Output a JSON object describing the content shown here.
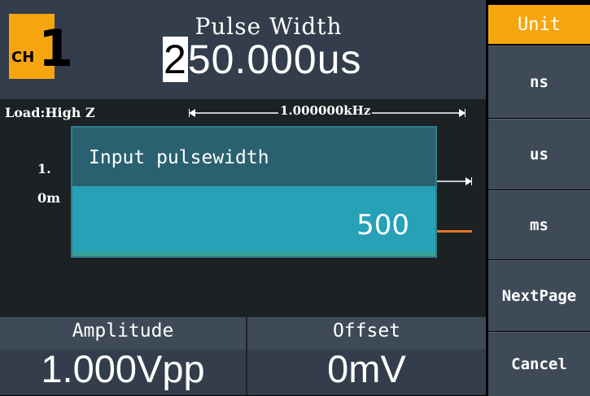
{
  "channel": {
    "label": "CH",
    "number": "1"
  },
  "param": {
    "title": "Pulse Width",
    "value_first_digit": "2",
    "value_rest": "50.000us"
  },
  "waveform": {
    "load": "Load:High Z",
    "frequency": "1.000000kHz",
    "amplitude_tag": "1.",
    "offset_tag": "0m"
  },
  "dialog": {
    "title": "Input pulsewidth",
    "value": "500"
  },
  "bottom": {
    "amplitude_label": "Amplitude",
    "amplitude_value": "1.000Vpp",
    "offset_label": "Offset",
    "offset_value": "0mV"
  },
  "menu": {
    "title": "Unit",
    "items": [
      "ns",
      "us",
      "ms",
      "NextPage",
      "Cancel"
    ]
  },
  "colors": {
    "accent": "#f5a60f",
    "dialog_body": "#27a1b5",
    "dialog_header": "#2a6170",
    "panel": "#333d4b",
    "waveform": "#e0782a"
  }
}
